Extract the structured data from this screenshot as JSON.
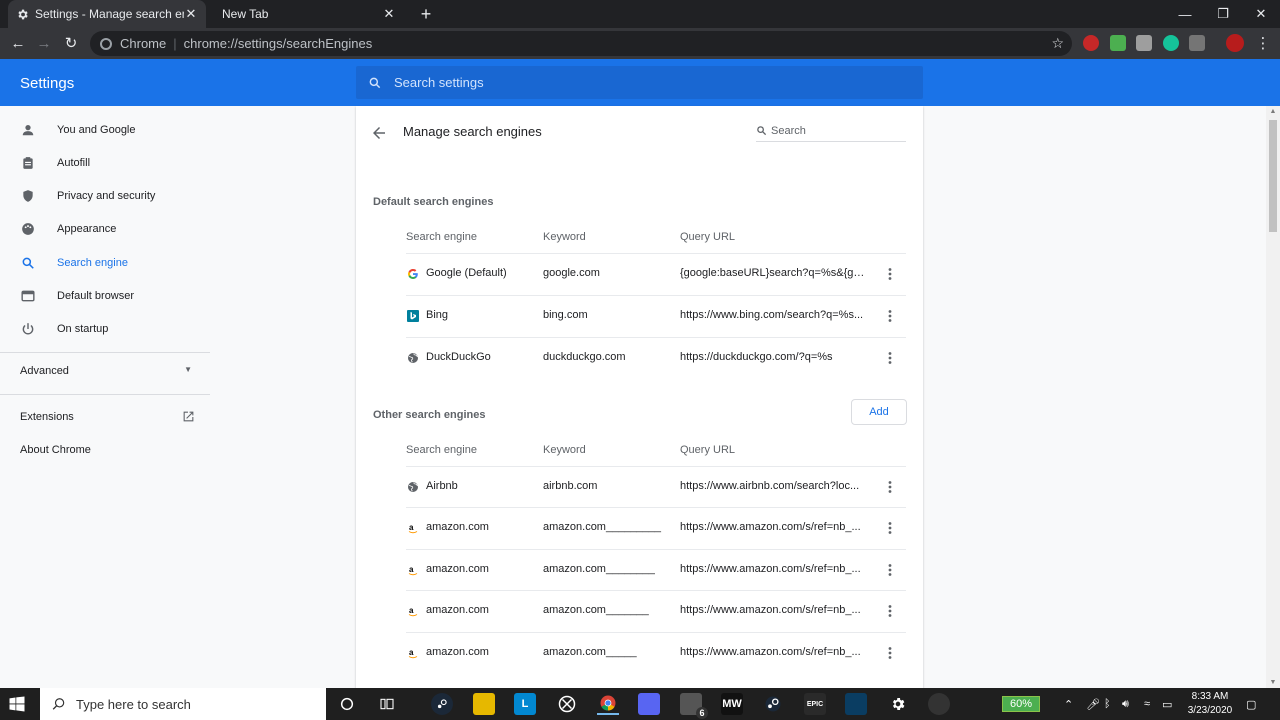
{
  "browser": {
    "tabs": [
      {
        "title": "Settings - Manage search engines",
        "active": true
      },
      {
        "title": "New Tab",
        "active": false
      }
    ],
    "omnibox": {
      "site": "Chrome",
      "url": "chrome://settings/searchEngines"
    }
  },
  "settings": {
    "title": "Settings",
    "search_placeholder": "Search settings"
  },
  "sidebar": {
    "items": [
      {
        "label": "You and Google",
        "icon": "person-icon"
      },
      {
        "label": "Autofill",
        "icon": "clipboard-icon"
      },
      {
        "label": "Privacy and security",
        "icon": "shield-icon"
      },
      {
        "label": "Appearance",
        "icon": "palette-icon"
      },
      {
        "label": "Search engine",
        "icon": "search-icon",
        "active": true
      },
      {
        "label": "Default browser",
        "icon": "browser-icon"
      },
      {
        "label": "On startup",
        "icon": "power-icon"
      }
    ],
    "advanced": "Advanced",
    "extensions": "Extensions",
    "about": "About Chrome"
  },
  "page": {
    "title": "Manage search engines",
    "search_placeholder": "Search",
    "default_section": "Default search engines",
    "other_section": "Other search engines",
    "add_label": "Add",
    "columns": {
      "engine": "Search engine",
      "keyword": "Keyword",
      "url": "Query URL"
    },
    "default_engines": [
      {
        "name": "Google (Default)",
        "keyword": "google.com",
        "url": "{google:baseURL}search?q=%s&{go...",
        "icon": "google-icon"
      },
      {
        "name": "Bing",
        "keyword": "bing.com",
        "url": "https://www.bing.com/search?q=%s...",
        "icon": "bing-icon"
      },
      {
        "name": "DuckDuckGo",
        "keyword": "duckduckgo.com",
        "url": "https://duckduckgo.com/?q=%s",
        "icon": "globe-icon"
      }
    ],
    "other_engines": [
      {
        "name": "Airbnb",
        "keyword": "airbnb.com",
        "url": "https://www.airbnb.com/search?loc...",
        "icon": "globe-icon"
      },
      {
        "name": "amazon.com",
        "keyword": "amazon.com_________",
        "url": "https://www.amazon.com/s/ref=nb_...",
        "icon": "amazon-icon"
      },
      {
        "name": "amazon.com",
        "keyword": "amazon.com________",
        "url": "https://www.amazon.com/s/ref=nb_...",
        "icon": "amazon-icon"
      },
      {
        "name": "amazon.com",
        "keyword": "amazon.com_______",
        "url": "https://www.amazon.com/s/ref=nb_...",
        "icon": "amazon-icon"
      },
      {
        "name": "amazon.com",
        "keyword": "amazon.com_____",
        "url": "https://www.amazon.com/s/ref=nb_...",
        "icon": "amazon-icon"
      }
    ]
  },
  "taskbar": {
    "search_placeholder": "Type here to search",
    "battery": "60%",
    "time": "8:33 AM",
    "date": "3/23/2020",
    "steam_badge": "6"
  },
  "colors": {
    "accent": "#1a73e8",
    "header": "#1a73e8",
    "tabstrip": "#202124"
  }
}
